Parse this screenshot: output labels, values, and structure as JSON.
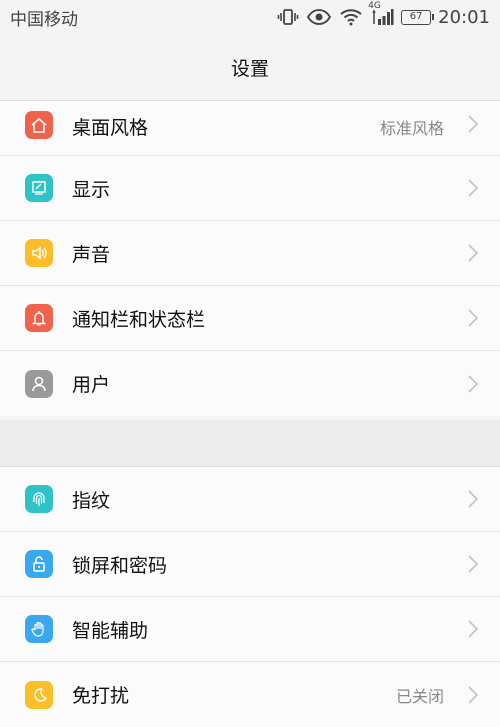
{
  "status": {
    "carrier": "中国移动",
    "network": "4G",
    "battery": "67",
    "time": "20:01"
  },
  "header": {
    "title": "设置"
  },
  "groups": [
    {
      "items": [
        {
          "label": "桌面风格",
          "value": "标准风格",
          "icon": "home-icon",
          "color": "#f0634a"
        },
        {
          "label": "显示",
          "value": "",
          "icon": "display-icon",
          "color": "#2fc2c6"
        },
        {
          "label": "声音",
          "value": "",
          "icon": "speaker-icon",
          "color": "#fbbd2a"
        },
        {
          "label": "通知栏和状态栏",
          "value": "",
          "icon": "bell-icon",
          "color": "#f0634a"
        },
        {
          "label": "用户",
          "value": "",
          "icon": "user-icon",
          "color": "#9a9a9a"
        }
      ]
    },
    {
      "items": [
        {
          "label": "指纹",
          "value": "",
          "icon": "fingerprint-icon",
          "color": "#2fc2c6"
        },
        {
          "label": "锁屏和密码",
          "value": "",
          "icon": "unlock-icon",
          "color": "#3aa8f0"
        },
        {
          "label": "智能辅助",
          "value": "",
          "icon": "hand-icon",
          "color": "#3aa8f0"
        },
        {
          "label": "免打扰",
          "value": "已关闭",
          "icon": "moon-icon",
          "color": "#fbbd2a"
        }
      ]
    }
  ]
}
